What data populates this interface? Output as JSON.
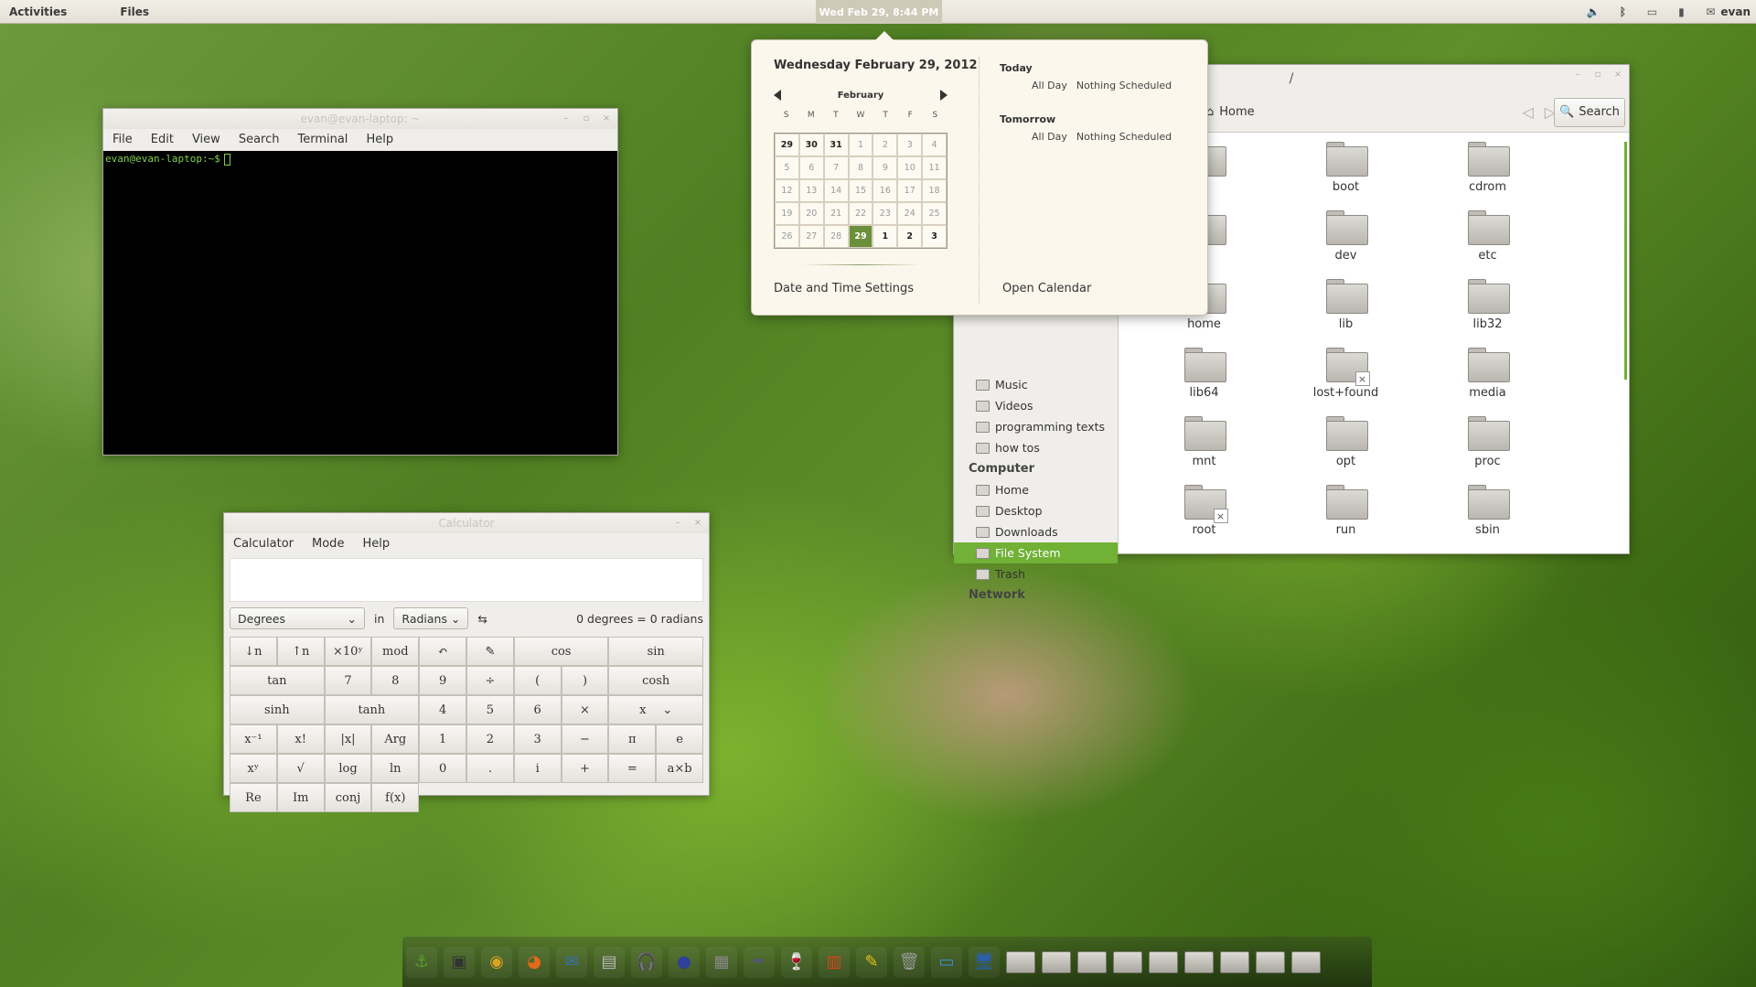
{
  "topbar": {
    "activities": "Activities",
    "app_name": "Files",
    "clock": "Wed Feb 29,  8:44 PM",
    "user": "evan"
  },
  "terminal": {
    "title": "evan@evan-laptop: ~",
    "menu": [
      "File",
      "Edit",
      "View",
      "Search",
      "Terminal",
      "Help"
    ],
    "prompt": "evan@evan-laptop:~$"
  },
  "calculator": {
    "title": "Calculator",
    "menu": [
      "Calculator",
      "Mode",
      "Help"
    ],
    "from_unit": "Degrees",
    "in_label": "in",
    "to_unit": "Radians",
    "swap_symbol": "⇆",
    "result": "0 degrees = 0 radians",
    "keys": [
      "↓n",
      "↑n",
      "×10ʸ",
      "mod",
      "↶",
      "✎",
      "cos",
      "",
      "sin",
      "",
      "tan",
      "",
      "7",
      "8",
      "9",
      "÷",
      "(",
      ")",
      "cosh",
      "",
      "sinh",
      "",
      "tanh",
      "",
      "4",
      "5",
      "6",
      "×",
      "x",
      "",
      "x⁻¹",
      "x!",
      "|x|",
      "Arg",
      "1",
      "2",
      "3",
      "−",
      "π",
      "e",
      "xʸ",
      "√",
      "log",
      "ln",
      "0",
      ".",
      "i",
      "+",
      "=",
      "a×b",
      "Re",
      "Im",
      "conj",
      "f(x)"
    ]
  },
  "files": {
    "title": "/",
    "path": "Home",
    "search_label": "Search",
    "sidebar": {
      "places_items": [
        "Music",
        "Videos",
        "programming texts",
        "how tos"
      ],
      "computer_head": "Computer",
      "computer_items": [
        "Home",
        "Desktop",
        "Downloads",
        "File System",
        "Trash"
      ],
      "network_head": "Network"
    },
    "folders": [
      {
        "name": "",
        "locked": false
      },
      {
        "name": "boot",
        "locked": false
      },
      {
        "name": "cdrom",
        "locked": false
      },
      {
        "name": "",
        "locked": false
      },
      {
        "name": "dev",
        "locked": false
      },
      {
        "name": "etc",
        "locked": false
      },
      {
        "name": "home",
        "locked": false
      },
      {
        "name": "lib",
        "locked": false
      },
      {
        "name": "lib32",
        "locked": false
      },
      {
        "name": "lib64",
        "locked": false
      },
      {
        "name": "lost+found",
        "locked": true
      },
      {
        "name": "media",
        "locked": false
      },
      {
        "name": "mnt",
        "locked": false
      },
      {
        "name": "opt",
        "locked": false
      },
      {
        "name": "proc",
        "locked": false
      },
      {
        "name": "root",
        "locked": true
      },
      {
        "name": "run",
        "locked": false
      },
      {
        "name": "sbin",
        "locked": false
      }
    ]
  },
  "calendar": {
    "date_heading": "Wednesday February 29, 2012",
    "month": "February",
    "weekdays": [
      "S",
      "M",
      "T",
      "W",
      "T",
      "F",
      "S"
    ],
    "days": [
      {
        "d": "29",
        "o": true
      },
      {
        "d": "30",
        "o": true
      },
      {
        "d": "31",
        "o": true
      },
      {
        "d": "1"
      },
      {
        "d": "2"
      },
      {
        "d": "3"
      },
      {
        "d": "4"
      },
      {
        "d": "5"
      },
      {
        "d": "6"
      },
      {
        "d": "7"
      },
      {
        "d": "8"
      },
      {
        "d": "9"
      },
      {
        "d": "10"
      },
      {
        "d": "11"
      },
      {
        "d": "12"
      },
      {
        "d": "13"
      },
      {
        "d": "14"
      },
      {
        "d": "15"
      },
      {
        "d": "16"
      },
      {
        "d": "17"
      },
      {
        "d": "18"
      },
      {
        "d": "19"
      },
      {
        "d": "20"
      },
      {
        "d": "21"
      },
      {
        "d": "22"
      },
      {
        "d": "23"
      },
      {
        "d": "24"
      },
      {
        "d": "25"
      },
      {
        "d": "26"
      },
      {
        "d": "27"
      },
      {
        "d": "28"
      },
      {
        "d": "29",
        "t": true
      },
      {
        "d": "1",
        "o": true
      },
      {
        "d": "2",
        "o": true
      },
      {
        "d": "3",
        "o": true
      }
    ],
    "today_label": "Today",
    "tomorrow_label": "Tomorrow",
    "all_day": "All Day",
    "nothing": "Nothing Scheduled",
    "settings_link": "Date and Time Settings",
    "open_link": "Open Calendar"
  },
  "dock": {
    "icons": [
      "anchor-icon",
      "terminal-icon",
      "media-player-icon",
      "firefox-icon",
      "thunderbird-icon",
      "document-icon",
      "headphones-icon",
      "globe-icon",
      "calculator-icon",
      "pen-icon",
      "wine-icon",
      "gift-icon",
      "notes-icon",
      "trash-icon",
      "desktop-icon",
      "computer-icon"
    ],
    "folder_count": 9
  }
}
